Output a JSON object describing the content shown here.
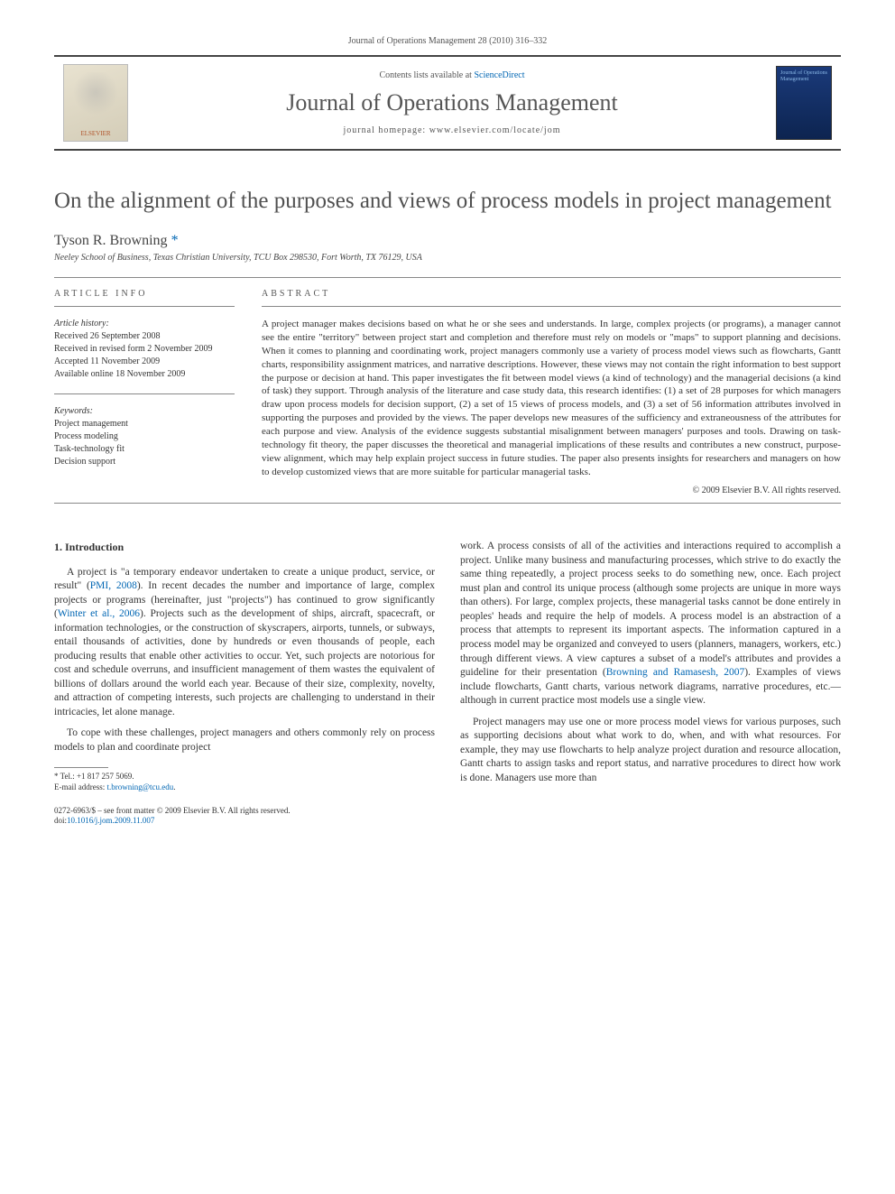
{
  "header": {
    "citation": "Journal of Operations Management 28 (2010) 316–332",
    "contents_prefix": "Contents lists available at ",
    "contents_link": "ScienceDirect",
    "journal_name": "Journal of Operations Management",
    "homepage": "journal homepage: www.elsevier.com/locate/jom",
    "publisher_logo": "ELSEVIER",
    "cover_text": "Journal of Operations Management"
  },
  "article": {
    "title": "On the alignment of the purposes and views of process models in project management",
    "author": "Tyson R. Browning",
    "author_marker": "*",
    "affiliation": "Neeley School of Business, Texas Christian University, TCU Box 298530, Fort Worth, TX 76129, USA"
  },
  "info": {
    "heading": "ARTICLE INFO",
    "history_label": "Article history:",
    "history": [
      "Received 26 September 2008",
      "Received in revised form 2 November 2009",
      "Accepted 11 November 2009",
      "Available online 18 November 2009"
    ],
    "keywords_label": "Keywords:",
    "keywords": [
      "Project management",
      "Process modeling",
      "Task-technology fit",
      "Decision support"
    ]
  },
  "abstract": {
    "heading": "ABSTRACT",
    "text": "A project manager makes decisions based on what he or she sees and understands. In large, complex projects (or programs), a manager cannot see the entire \"territory\" between project start and completion and therefore must rely on models or \"maps\" to support planning and decisions. When it comes to planning and coordinating work, project managers commonly use a variety of process model views such as flowcharts, Gantt charts, responsibility assignment matrices, and narrative descriptions. However, these views may not contain the right information to best support the purpose or decision at hand. This paper investigates the fit between model views (a kind of technology) and the managerial decisions (a kind of task) they support. Through analysis of the literature and case study data, this research identifies: (1) a set of 28 purposes for which managers draw upon process models for decision support, (2) a set of 15 views of process models, and (3) a set of 56 information attributes involved in supporting the purposes and provided by the views. The paper develops new measures of the sufficiency and extraneousness of the attributes for each purpose and view. Analysis of the evidence suggests substantial misalignment between managers' purposes and tools. Drawing on task-technology fit theory, the paper discusses the theoretical and managerial implications of these results and contributes a new construct, purpose-view alignment, which may help explain project success in future studies. The paper also presents insights for researchers and managers on how to develop customized views that are more suitable for particular managerial tasks.",
    "copyright": "© 2009 Elsevier B.V. All rights reserved."
  },
  "body": {
    "section_heading": "1. Introduction",
    "col1_p1_a": "A project is \"a temporary endeavor undertaken to create a unique product, service, or result\" (",
    "col1_p1_link1": "PMI, 2008",
    "col1_p1_b": "). In recent decades the number and importance of large, complex projects or programs (hereinafter, just \"projects\") has continued to grow significantly (",
    "col1_p1_link2": "Winter et al., 2006",
    "col1_p1_c": "). Projects such as the development of ships, aircraft, spacecraft, or information technologies, or the construction of skyscrapers, airports, tunnels, or subways, entail thousands of activities, done by hundreds or even thousands of people, each producing results that enable other activities to occur. Yet, such projects are notorious for cost and schedule overruns, and insufficient management of them wastes the equivalent of billions of dollars around the world each year. Because of their size, complexity, novelty, and attraction of competing interests, such projects are challenging to understand in their intricacies, let alone manage.",
    "col1_p2": "To cope with these challenges, project managers and others commonly rely on process models to plan and coordinate project",
    "col2_p1_a": "work. A process consists of all of the activities and interactions required to accomplish a project. Unlike many business and manufacturing processes, which strive to do exactly the same thing repeatedly, a project process seeks to do something new, once. Each project must plan and control its unique process (although some projects are unique in more ways than others). For large, complex projects, these managerial tasks cannot be done entirely in peoples' heads and require the help of models. A process model is an abstraction of a process that attempts to represent its important aspects. The information captured in a process model may be organized and conveyed to users (planners, managers, workers, etc.) through different views. A view captures a subset of a model's attributes and provides a guideline for their presentation (",
    "col2_p1_link1": "Browning and Ramasesh, 2007",
    "col2_p1_b": "). Examples of views include flowcharts, Gantt charts, various network diagrams, narrative procedures, etc.—although in current practice most models use a single view.",
    "col2_p2": "Project managers may use one or more process model views for various purposes, such as supporting decisions about what work to do, when, and with what resources. For example, they may use flowcharts to help analyze project duration and resource allocation, Gantt charts to assign tasks and report status, and narrative procedures to direct how work is done. Managers use more than"
  },
  "footnote": {
    "tel_label": "* Tel.: ",
    "tel": "+1 817 257 5069.",
    "email_label": "E-mail address: ",
    "email": "t.browning@tcu.edu"
  },
  "footer": {
    "line1": "0272-6963/$ – see front matter © 2009 Elsevier B.V. All rights reserved.",
    "doi_prefix": "doi:",
    "doi": "10.1016/j.jom.2009.11.007"
  }
}
